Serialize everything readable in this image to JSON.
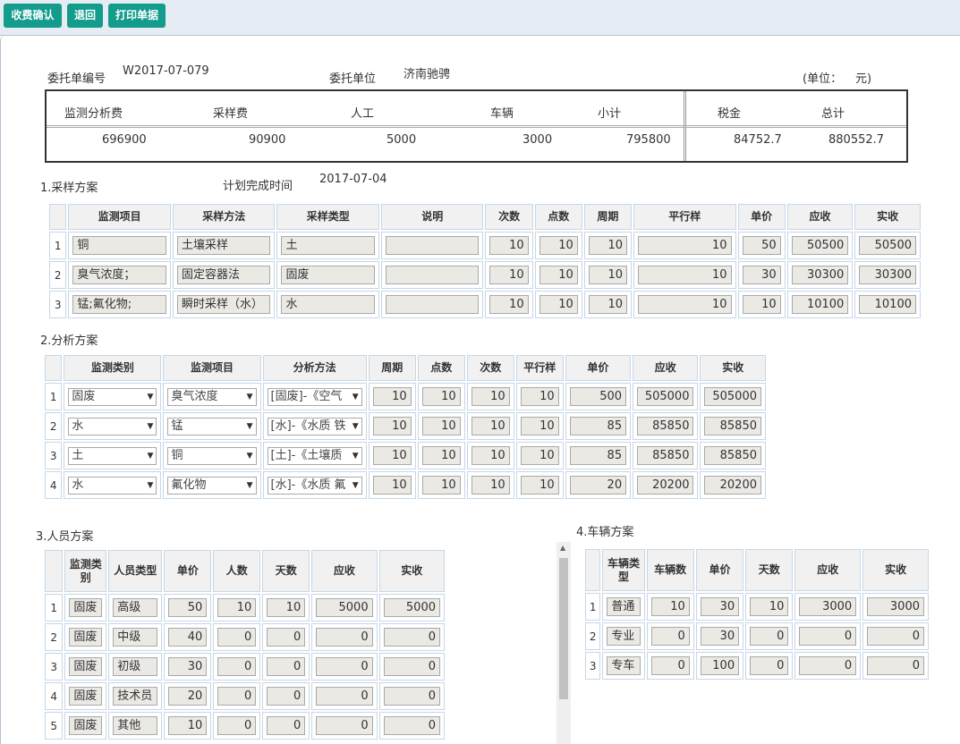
{
  "toolbar": {
    "confirm": "收费确认",
    "back": "退回",
    "print": "打印单据"
  },
  "header": {
    "order_no_label": "委托单编号",
    "order_no": "W2017-07-079",
    "client_label": "委托单位",
    "client": "济南驰骋",
    "unit_label": "(单位：",
    "unit": "元)"
  },
  "summary": {
    "headers": [
      "监测分析费",
      "采样费",
      "人工",
      "车辆",
      "小计",
      "税金",
      "总计"
    ],
    "values": [
      "696900",
      "90900",
      "5000",
      "3000",
      "795800",
      "84752.7",
      "880552.7"
    ]
  },
  "sampling": {
    "title": "1.采样方案",
    "plan_label": "计划完成时间",
    "plan_date": "2017-07-04",
    "headers": [
      "监测项目",
      "采样方法",
      "采样类型",
      "说明",
      "次数",
      "点数",
      "周期",
      "平行样",
      "单价",
      "应收",
      "实收"
    ],
    "rows": [
      {
        "idx": "1",
        "item": "铜",
        "method": "土壤采样",
        "type": "土",
        "note": "",
        "times": "10",
        "points": "10",
        "period": "10",
        "parallel": "10",
        "price": "50",
        "receivable": "50500",
        "received": "50500"
      },
      {
        "idx": "2",
        "item": "臭气浓度；",
        "method": "固定容器法",
        "type": "固废",
        "note": "",
        "times": "10",
        "points": "10",
        "period": "10",
        "parallel": "10",
        "price": "30",
        "receivable": "30300",
        "received": "30300"
      },
      {
        "idx": "3",
        "item": "锰;氟化物;",
        "method": "瞬时采样（水）",
        "type": "水",
        "note": "",
        "times": "10",
        "points": "10",
        "period": "10",
        "parallel": "10",
        "price": "10",
        "receivable": "10100",
        "received": "10100"
      }
    ]
  },
  "analysis": {
    "title": "2.分析方案",
    "headers": [
      "监测类别",
      "监测项目",
      "分析方法",
      "周期",
      "点数",
      "次数",
      "平行样",
      "单价",
      "应收",
      "实收"
    ],
    "rows": [
      {
        "idx": "1",
        "category": "固废",
        "item": "臭气浓度",
        "method": "[固废]-《空气",
        "period": "10",
        "points": "10",
        "times": "10",
        "parallel": "10",
        "price": "500",
        "receivable": "505000",
        "received": "505000"
      },
      {
        "idx": "2",
        "category": "水",
        "item": "锰",
        "method": "[水]-《水质 铁",
        "period": "10",
        "points": "10",
        "times": "10",
        "parallel": "10",
        "price": "85",
        "receivable": "85850",
        "received": "85850"
      },
      {
        "idx": "3",
        "category": "土",
        "item": "铜",
        "method": "[土]-《土壤质",
        "period": "10",
        "points": "10",
        "times": "10",
        "parallel": "10",
        "price": "85",
        "receivable": "85850",
        "received": "85850"
      },
      {
        "idx": "4",
        "category": "水",
        "item": "氟化物",
        "method": "[水]-《水质 氟",
        "period": "10",
        "points": "10",
        "times": "10",
        "parallel": "10",
        "price": "20",
        "receivable": "20200",
        "received": "20200"
      }
    ]
  },
  "staff": {
    "title": "3.人员方案",
    "headers": [
      "监测类别",
      "人员类型",
      "单价",
      "人数",
      "天数",
      "应收",
      "实收"
    ],
    "rows": [
      {
        "idx": "1",
        "category": "固废",
        "type": "高级",
        "price": "50",
        "count": "10",
        "days": "10",
        "receivable": "5000",
        "received": "5000"
      },
      {
        "idx": "2",
        "category": "固废",
        "type": "中级",
        "price": "40",
        "count": "0",
        "days": "0",
        "receivable": "0",
        "received": "0"
      },
      {
        "idx": "3",
        "category": "固废",
        "type": "初级",
        "price": "30",
        "count": "0",
        "days": "0",
        "receivable": "0",
        "received": "0"
      },
      {
        "idx": "4",
        "category": "固废",
        "type": "技术员",
        "price": "20",
        "count": "0",
        "days": "0",
        "receivable": "0",
        "received": "0"
      },
      {
        "idx": "5",
        "category": "固废",
        "type": "其他",
        "price": "10",
        "count": "0",
        "days": "0",
        "receivable": "0",
        "received": "0"
      }
    ]
  },
  "vehicle": {
    "title": "4.车辆方案",
    "headers": [
      "车辆类型",
      "车辆数",
      "单价",
      "天数",
      "应收",
      "实收"
    ],
    "rows": [
      {
        "idx": "1",
        "type": "普通",
        "count": "10",
        "price": "30",
        "days": "10",
        "receivable": "3000",
        "received": "3000"
      },
      {
        "idx": "2",
        "type": "专业",
        "count": "0",
        "price": "30",
        "days": "0",
        "receivable": "0",
        "received": "0"
      },
      {
        "idx": "3",
        "type": "专车",
        "count": "0",
        "price": "100",
        "days": "0",
        "receivable": "0",
        "received": "0"
      }
    ]
  },
  "icons": {
    "dropdown": "chevron-down-icon",
    "scroll_up": "scroll-up-arrow-icon"
  }
}
